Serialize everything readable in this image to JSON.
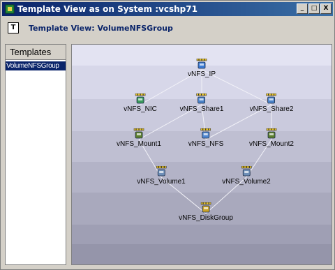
{
  "window": {
    "title": "Template View as on System :vcshp71",
    "minimize_label": "_",
    "maximize_label": "□",
    "close_label": "X"
  },
  "header": {
    "icon_label": "T",
    "subtitle": "Template View: VolumeNFSGroup"
  },
  "templates_panel": {
    "heading": "Templates",
    "items": [
      {
        "label": "VolumeNFSGroup",
        "selected": true
      }
    ]
  },
  "graph": {
    "nodes": [
      {
        "id": "ip",
        "label": "vNFS_IP",
        "icon": "ip-resource-icon"
      },
      {
        "id": "nic",
        "label": "vNFS_NIC",
        "icon": "nic-resource-icon"
      },
      {
        "id": "share1",
        "label": "vNFS_Share1",
        "icon": "share-resource-icon"
      },
      {
        "id": "share2",
        "label": "vNFS_Share2",
        "icon": "share-resource-icon"
      },
      {
        "id": "mount1",
        "label": "vNFS_Mount1",
        "icon": "mount-resource-icon"
      },
      {
        "id": "nfs",
        "label": "vNFS_NFS",
        "icon": "nfs-resource-icon"
      },
      {
        "id": "mount2",
        "label": "vNFS_Mount2",
        "icon": "mount-resource-icon"
      },
      {
        "id": "volume1",
        "label": "vNFS_Volume1",
        "icon": "volume-resource-icon"
      },
      {
        "id": "volume2",
        "label": "vNFS_Volume2",
        "icon": "volume-resource-icon"
      },
      {
        "id": "diskgroup",
        "label": "vNFS_DiskGroup",
        "icon": "diskgroup-resource-icon"
      }
    ],
    "edges": [
      [
        "ip",
        "nic"
      ],
      [
        "ip",
        "share1"
      ],
      [
        "ip",
        "share2"
      ],
      [
        "share1",
        "mount1"
      ],
      [
        "share1",
        "nfs"
      ],
      [
        "share2",
        "nfs"
      ],
      [
        "share2",
        "mount2"
      ],
      [
        "mount1",
        "volume1"
      ],
      [
        "mount2",
        "volume2"
      ],
      [
        "volume1",
        "diskgroup"
      ],
      [
        "volume2",
        "diskgroup"
      ]
    ]
  }
}
